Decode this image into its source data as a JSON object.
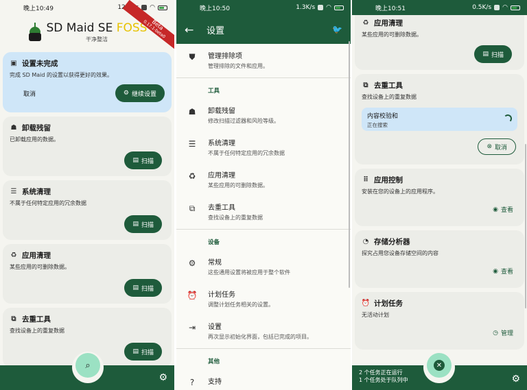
{
  "screen1": {
    "status": {
      "time": "晚上10:49",
      "speed": "127K/s"
    },
    "app_title": "SD Maid SE",
    "app_title_suffix": "FOSS",
    "app_subtitle": "干净整洁",
    "beta_label": "Beta",
    "beta_version": "0.17.1-beta0",
    "setup_card": {
      "title": "设置未完成",
      "desc": "完成 SD Maid 的设置以获得更好的效果。",
      "cancel": "取消",
      "continue": "继续设置"
    },
    "tools": [
      {
        "title": "卸载残留",
        "desc": "已卸载应用的数据。",
        "action": "扫描",
        "icon": "ghost-icon"
      },
      {
        "title": "系统清理",
        "desc": "不属于任何特定应用的冗余数据",
        "action": "扫描",
        "icon": "list-icon"
      },
      {
        "title": "应用清理",
        "desc": "某些应用的可删除数据。",
        "action": "扫描",
        "icon": "recycle-icon"
      },
      {
        "title": "去重工具",
        "desc": "查找设备上的重复数据",
        "action": "扫描",
        "icon": "duplicate-icon"
      }
    ]
  },
  "screen2": {
    "status": {
      "time": "晚上10:50",
      "speed": "1.3K/s"
    },
    "title": "设置",
    "items_top": [
      {
        "title": "管理排除项",
        "desc": "管理排除的文件和应用。",
        "icon": "shield-icon"
      }
    ],
    "section_tools": "工具",
    "items_tools": [
      {
        "title": "卸载残留",
        "desc": "修改扫描过滤器和风险等级。",
        "icon": "ghost-icon"
      },
      {
        "title": "系统清理",
        "desc": "不属于任何特定应用的冗余数据",
        "icon": "list-icon"
      },
      {
        "title": "应用清理",
        "desc": "某些应用的可删除数据。",
        "icon": "recycle-icon"
      },
      {
        "title": "去重工具",
        "desc": "查找设备上的重复数据",
        "icon": "duplicate-icon"
      }
    ],
    "section_device": "设备",
    "items_device": [
      {
        "title": "常规",
        "desc": "这些通用设置将被应用于整个软件",
        "icon": "gear-icon"
      },
      {
        "title": "计划任务",
        "desc": "调整计划任务相关的设置。",
        "icon": "alarm-icon"
      },
      {
        "title": "设置",
        "desc": "再次显示初始化界面，包括已完成的项目。",
        "icon": "setup-icon"
      }
    ],
    "section_other": "其他",
    "items_other": [
      {
        "title": "支持",
        "desc": "",
        "icon": "help-icon"
      }
    ]
  },
  "screen3": {
    "status": {
      "time": "晚上10:51",
      "speed": "0.5K/s"
    },
    "app_clean": {
      "title": "应用清理",
      "desc": "某些应用的可删除数据。",
      "action": "扫描"
    },
    "dedupe": {
      "title": "去重工具",
      "desc": "查找设备上的重复数据",
      "progress_title": "内容校验和",
      "progress_sub": "正在搜索",
      "cancel": "取消"
    },
    "app_control": {
      "title": "应用控制",
      "desc": "安装在您的设备上的应用程序。",
      "action": "查看"
    },
    "storage": {
      "title": "存储分析器",
      "desc": "探究占用您设备存储空间的内容",
      "action": "查看"
    },
    "scheduler": {
      "title": "计划任务",
      "desc": "无活动计划",
      "action": "管理"
    },
    "tasks_running": "2 个任务正在运行",
    "tasks_queued": "1 个任务处于队列中"
  }
}
